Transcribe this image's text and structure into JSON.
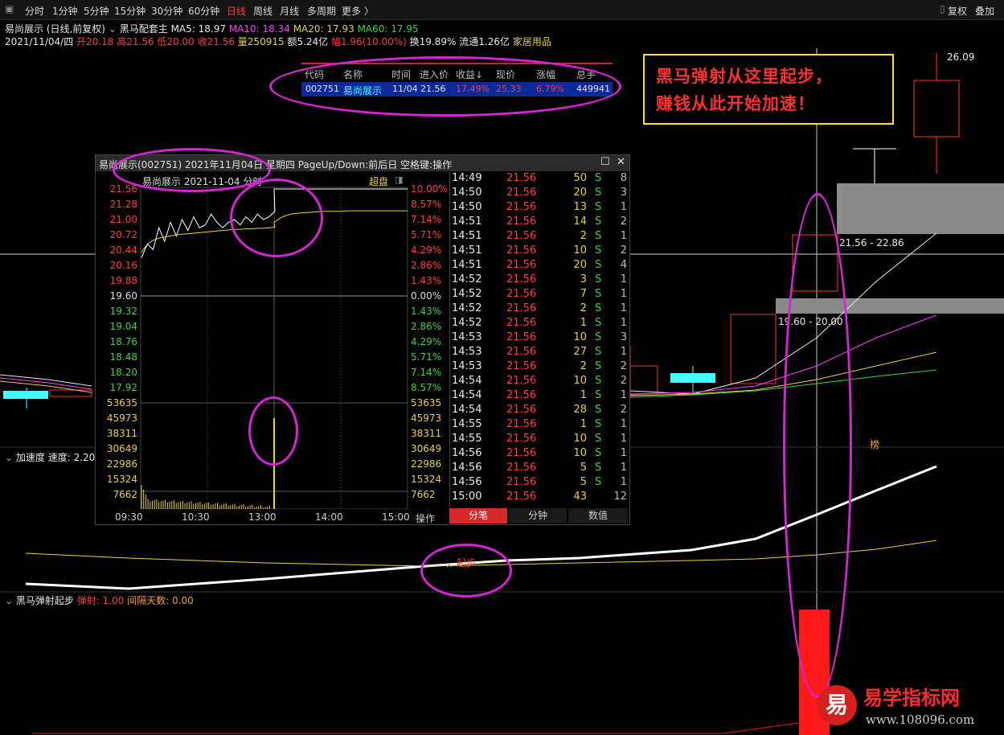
{
  "toolbar": {
    "periods": [
      "分时",
      "1分钟",
      "5分钟",
      "15分钟",
      "30分钟",
      "60分钟",
      "日线",
      "周线",
      "月线",
      "多周期",
      "更多 〉"
    ],
    "active": "日线",
    "right": [
      "复权",
      "叠加"
    ]
  },
  "header": {
    "title": "易尚展示 (日线,前复权)",
    "indicator": "黑马配套主",
    "ma5": "MA5: 18.97",
    "ma10": "MA10: 18.34",
    "ma20": "MA20: 17.93",
    "ma60": "MA60: 17.95",
    "date": "2021/11/04/四",
    "open": "开20.18",
    "high": "高21.56",
    "low": "低20.00",
    "close": "收21.56",
    "volume": "量250915",
    "amount": "额5.24亿",
    "change": "幅1.96(10.00%)",
    "turnover": "换19.89%",
    "float": "流通1.26亿",
    "sector": "家居用品"
  },
  "signal_table": {
    "headers": [
      "代码",
      "名称",
      "时间",
      "进入价",
      "收益↓",
      "现价",
      "涨幅",
      "总手"
    ],
    "row": [
      "002751",
      "易尚展示",
      "11/04",
      "21.56",
      "17.49%",
      "25.33",
      "6.79%",
      "449941"
    ]
  },
  "promo": {
    "line1": "黑马弹射从这里起步，",
    "line2": "赚钱从此开始加速！"
  },
  "kline": {
    "price_high": "26.09",
    "box1": "21.56 - 22.86",
    "box2": "19.60 - 20.00",
    "badge": "榜"
  },
  "popup": {
    "title": "易尚展示(002751) 2021年11月04日 星期四 PageUp/Down:前后日 空格键:操作",
    "subtitle": "易尚展示   2021-11-04 分时",
    "super": "超盘",
    "price_ticks": [
      "21.56",
      "21.28",
      "21.00",
      "20.72",
      "20.44",
      "20.16",
      "19.88",
      "19.60",
      "19.32",
      "19.04",
      "18.76",
      "18.48",
      "18.20",
      "17.92"
    ],
    "pct_ticks": [
      "10.00%",
      "8.57%",
      "7.14%",
      "5.71%",
      "4.29%",
      "2.86%",
      "1.43%",
      "0.00%",
      "1.43%",
      "2.86%",
      "4.29%",
      "5.71%",
      "7.14%",
      "8.57%"
    ],
    "vol_ticks": [
      "53635",
      "45973",
      "38311",
      "30649",
      "22986",
      "15324",
      "7662"
    ],
    "time_ticks": [
      "09:30",
      "10:30",
      "13:00",
      "14:00",
      "15:00"
    ],
    "ops_label": "操作",
    "tabs": [
      "分笔",
      "分钟",
      "数值"
    ],
    "ticks_table": [
      [
        "14:49",
        "21.56",
        "50",
        "S",
        "8"
      ],
      [
        "14:50",
        "21.56",
        "20",
        "S",
        "3"
      ],
      [
        "14:50",
        "21.56",
        "13",
        "S",
        "1"
      ],
      [
        "14:51",
        "21.56",
        "14",
        "S",
        "2"
      ],
      [
        "14:51",
        "21.56",
        "2",
        "S",
        "1"
      ],
      [
        "14:51",
        "21.56",
        "10",
        "S",
        "2"
      ],
      [
        "14:51",
        "21.56",
        "20",
        "S",
        "4"
      ],
      [
        "14:52",
        "21.56",
        "3",
        "S",
        "1"
      ],
      [
        "14:52",
        "21.56",
        "7",
        "S",
        "1"
      ],
      [
        "14:52",
        "21.56",
        "2",
        "S",
        "1"
      ],
      [
        "14:52",
        "21.56",
        "1",
        "S",
        "1"
      ],
      [
        "14:53",
        "21.56",
        "10",
        "S",
        "3"
      ],
      [
        "14:53",
        "21.56",
        "27",
        "S",
        "1"
      ],
      [
        "14:53",
        "21.56",
        "2",
        "S",
        "2"
      ],
      [
        "14:54",
        "21.56",
        "10",
        "S",
        "2"
      ],
      [
        "14:54",
        "21.56",
        "1",
        "S",
        "1"
      ],
      [
        "14:54",
        "21.56",
        "28",
        "S",
        "2"
      ],
      [
        "14:55",
        "21.56",
        "1",
        "S",
        "1"
      ],
      [
        "14:55",
        "21.56",
        "10",
        "S",
        "1"
      ],
      [
        "14:56",
        "21.56",
        "10",
        "S",
        "1"
      ],
      [
        "14:56",
        "21.56",
        "5",
        "S",
        "1"
      ],
      [
        "14:56",
        "21.56",
        "5",
        "S",
        "1"
      ],
      [
        "15:00",
        "21.56",
        "43",
        "",
        "12"
      ]
    ]
  },
  "chart_data": {
    "type": "line",
    "intraday_price": [
      20.3,
      20.55,
      20.45,
      20.85,
      20.6,
      20.95,
      20.7,
      21.0,
      20.8,
      21.05,
      20.85,
      20.9,
      21.1,
      20.95,
      20.85,
      20.95,
      21.0,
      20.9,
      21.05,
      20.95,
      21.1,
      21.0,
      21.05,
      21.15,
      21.56,
      21.56,
      21.56,
      21.56,
      21.56,
      21.56,
      21.56,
      21.56,
      21.56,
      21.56,
      21.56,
      21.56,
      21.56,
      21.56,
      21.56,
      21.56,
      21.56
    ],
    "avg_price": [
      20.4,
      20.55,
      20.62,
      20.66,
      20.68,
      20.7,
      20.72,
      20.73,
      20.74,
      20.75,
      20.76,
      20.77,
      20.78,
      20.79,
      20.8,
      20.81,
      20.82,
      20.82,
      20.83,
      20.83,
      20.84,
      20.84,
      20.85,
      20.86,
      20.95,
      21.05,
      21.1,
      21.12,
      21.13,
      21.14,
      21.15,
      21.15,
      21.15,
      21.16,
      21.16,
      21.16,
      21.16,
      21.16,
      21.16,
      21.16,
      21.16
    ],
    "volume_spike": 45973,
    "price_range": [
      17.92,
      21.56
    ],
    "volume_range": [
      0,
      53635
    ]
  },
  "indicator1": {
    "name": "加速度",
    "value": "速度: 2.20",
    "marker": "起步"
  },
  "indicator2": {
    "name": "黑马弹射起步",
    "tan": "弹射: 1.00",
    "gap": "间隔天数: 0.00"
  },
  "watermark": {
    "logo": "易",
    "name": "易学指标网",
    "url": "www.108096.com"
  }
}
